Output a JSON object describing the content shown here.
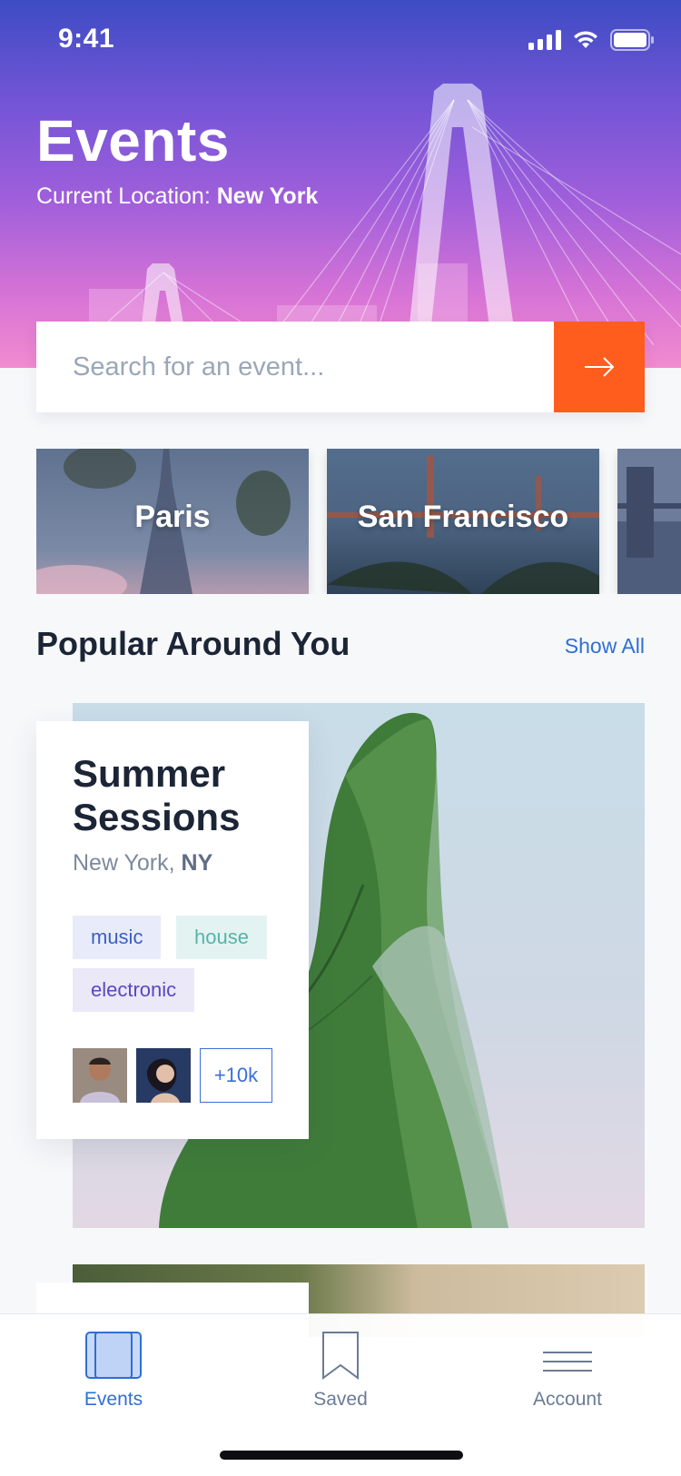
{
  "status_bar": {
    "time": "9:41"
  },
  "header": {
    "title": "Events",
    "location_prefix": "Current Location: ",
    "location_city": "New York"
  },
  "search": {
    "placeholder": "Search for an event..."
  },
  "cities": [
    {
      "name": "Paris"
    },
    {
      "name": "San Francisco"
    }
  ],
  "popular": {
    "title": "Popular Around You",
    "show_all": "Show All"
  },
  "event": {
    "title_line1": "Summer",
    "title_line2": "Sessions",
    "city": "New York, ",
    "state": "NY",
    "tags": [
      "music",
      "house",
      "electronic"
    ],
    "attendees_more": "+10k"
  },
  "tabbar": {
    "items": [
      {
        "label": "Events",
        "active": true
      },
      {
        "label": "Saved",
        "active": false
      },
      {
        "label": "Account",
        "active": false
      }
    ]
  },
  "colors": {
    "accent": "#ff5d1e",
    "link": "#2f6fd6",
    "header_top": "#3d4cc4",
    "header_bottom": "#f28bcf"
  }
}
